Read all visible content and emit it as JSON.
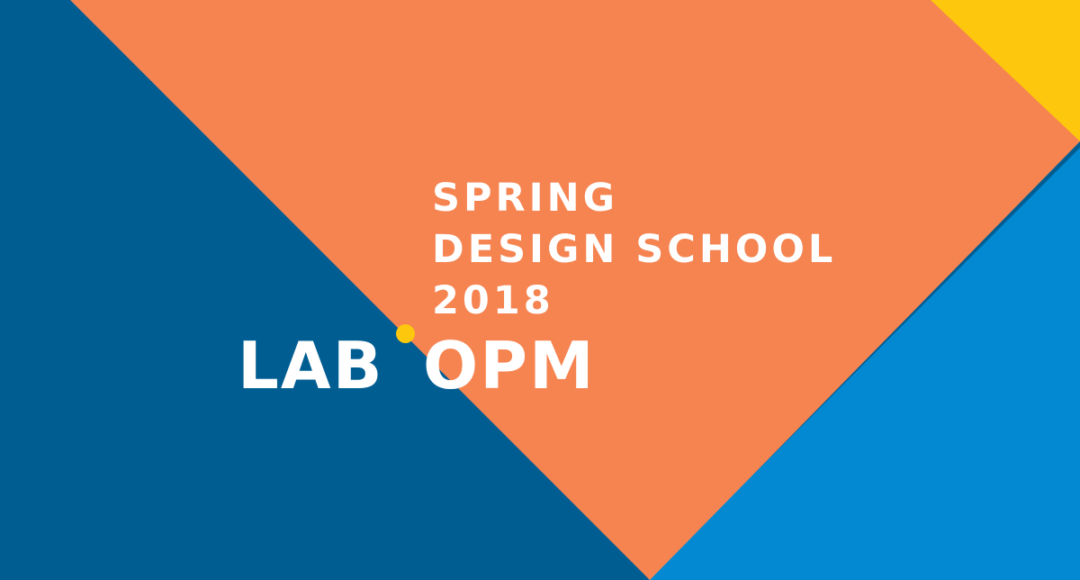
{
  "headline": {
    "line1": "SPRING",
    "line2": "DESIGN SCHOOL",
    "line3": "2018"
  },
  "logo": {
    "part1": "LAB",
    "part2": "OPM"
  },
  "colors": {
    "dark_blue": "#005D92",
    "orange": "#F58451",
    "yellow": "#FDC70D",
    "light_blue": "#0289D2",
    "text": "#FFFFFF"
  }
}
